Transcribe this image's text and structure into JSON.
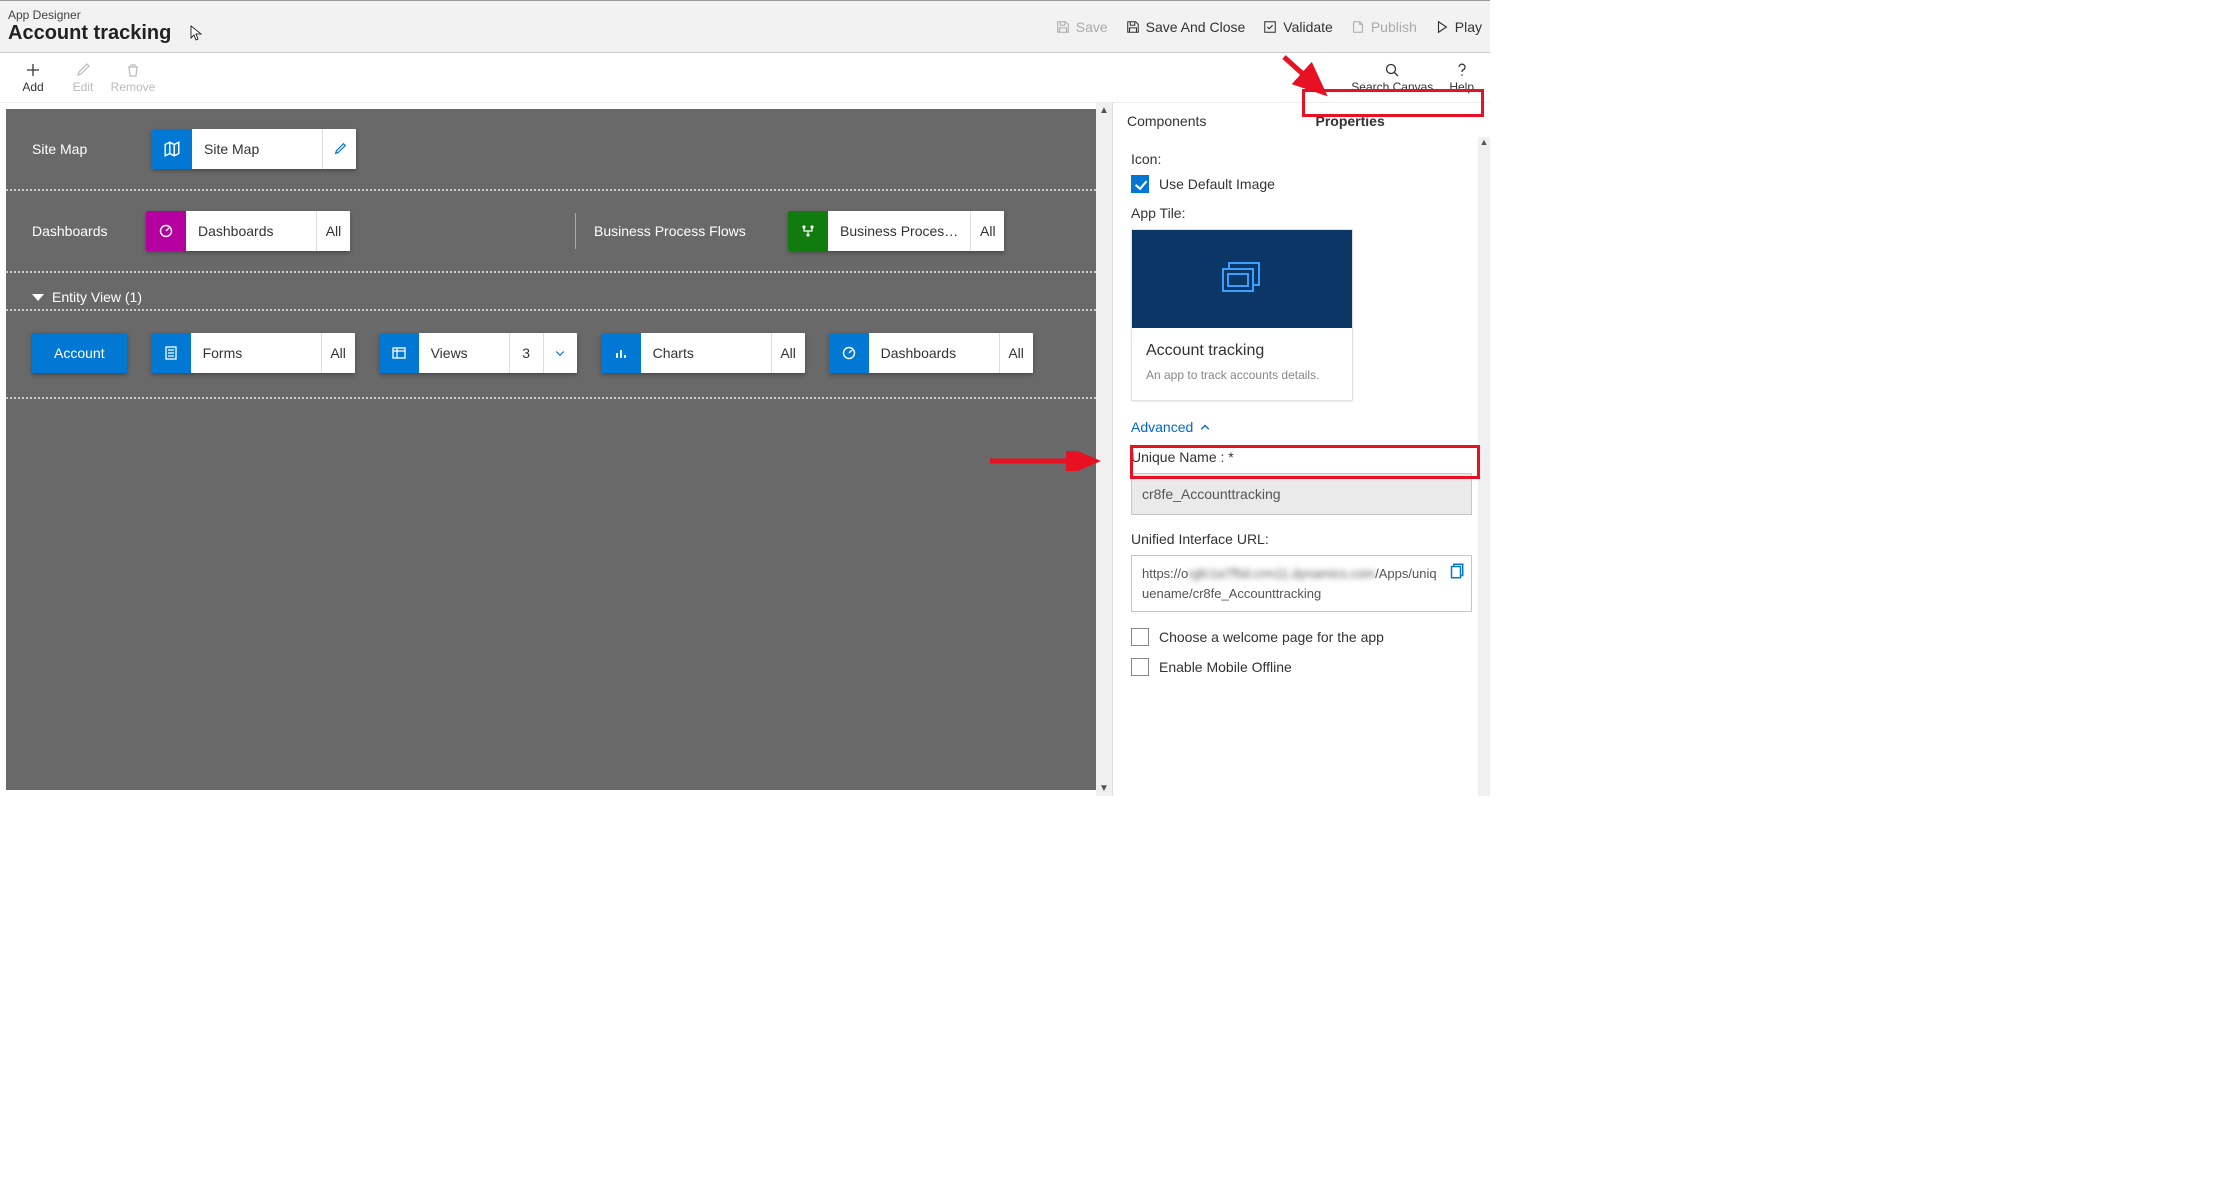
{
  "header": {
    "subtitle": "App Designer",
    "title": "Account tracking",
    "actions": {
      "save": "Save",
      "save_close": "Save And Close",
      "validate": "Validate",
      "publish": "Publish",
      "play": "Play"
    }
  },
  "toolbar": {
    "add": "Add",
    "edit": "Edit",
    "remove": "Remove",
    "search": "Search Canvas",
    "help": "Help"
  },
  "canvas": {
    "sitemap_label": "Site Map",
    "sitemap_card": "Site Map",
    "dashboards_label": "Dashboards",
    "dashboards_card": "Dashboards",
    "dashboards_suffix": "All",
    "bpf_label": "Business Process Flows",
    "bpf_card": "Business Proces…",
    "bpf_suffix": "All",
    "entity_toggle": "Entity View (1)",
    "entity_name": "Account",
    "forms": {
      "label": "Forms",
      "suffix": "All"
    },
    "views": {
      "label": "Views",
      "suffix": "3"
    },
    "charts": {
      "label": "Charts",
      "suffix": "All"
    },
    "entity_dashboards": {
      "label": "Dashboards",
      "suffix": "All"
    }
  },
  "sidepanel": {
    "tab_components": "Components",
    "tab_properties": "Properties",
    "icon_label": "Icon:",
    "use_default": "Use Default Image",
    "app_tile_label": "App Tile:",
    "tile_name": "Account tracking",
    "tile_desc": "An app to track accounts details.",
    "advanced": "Advanced",
    "unique_name_label": "Unique Name : *",
    "unique_name_value": "cr8fe_Accounttracking",
    "url_label": "Unified Interface URL:",
    "url_part1": "https://o",
    "url_blur": "rgfc1a7f5d.crm11.dynamics.com",
    "url_part2": "/Apps/uniquename/cr8fe_Accounttracking",
    "welcome_page": "Choose a welcome page for the app",
    "enable_offline": "Enable Mobile Offline"
  }
}
